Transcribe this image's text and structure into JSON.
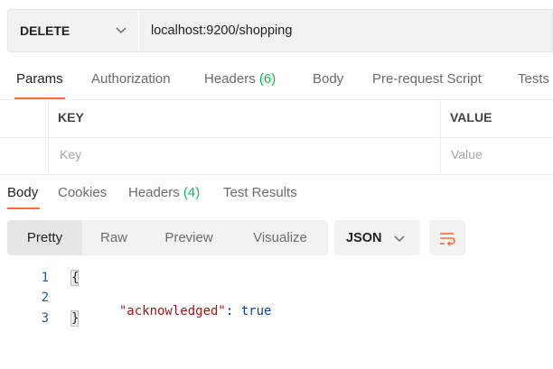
{
  "request": {
    "method": "DELETE",
    "url": "localhost:9200/shopping"
  },
  "request_tabs": [
    {
      "label": "Params",
      "count": "",
      "active": true
    },
    {
      "label": "Authorization",
      "count": ""
    },
    {
      "label": "Headers",
      "count": "(6)"
    },
    {
      "label": "Body",
      "count": ""
    },
    {
      "label": "Pre-request Script",
      "count": ""
    },
    {
      "label": "Tests",
      "count": ""
    }
  ],
  "params_table": {
    "headers": [
      "KEY",
      "VALUE"
    ],
    "placeholders": [
      "Key",
      "Value"
    ]
  },
  "response_tabs": [
    {
      "label": "Body",
      "count": "",
      "active": true
    },
    {
      "label": "Cookies",
      "count": ""
    },
    {
      "label": "Headers",
      "count": "(4)"
    },
    {
      "label": "Test Results",
      "count": ""
    }
  ],
  "view_modes": [
    "Pretty",
    "Raw",
    "Preview",
    "Visualize"
  ],
  "active_view_mode": "Pretty",
  "format": "JSON",
  "code": {
    "line_numbers": [
      "1",
      "2",
      "3"
    ],
    "open_brace": "{",
    "key": "\"acknowledged\"",
    "colon": ": ",
    "value": "true",
    "close_brace": "}"
  },
  "colors": {
    "accent": "#ff6c37",
    "count": "#0cbb52",
    "json_key": "#a31515",
    "json_bool": "#0f3f9f"
  },
  "icons": {
    "method_dropdown": "chevron-down-icon",
    "format_dropdown": "chevron-down-icon",
    "wrap": "wrap-lines-icon"
  }
}
